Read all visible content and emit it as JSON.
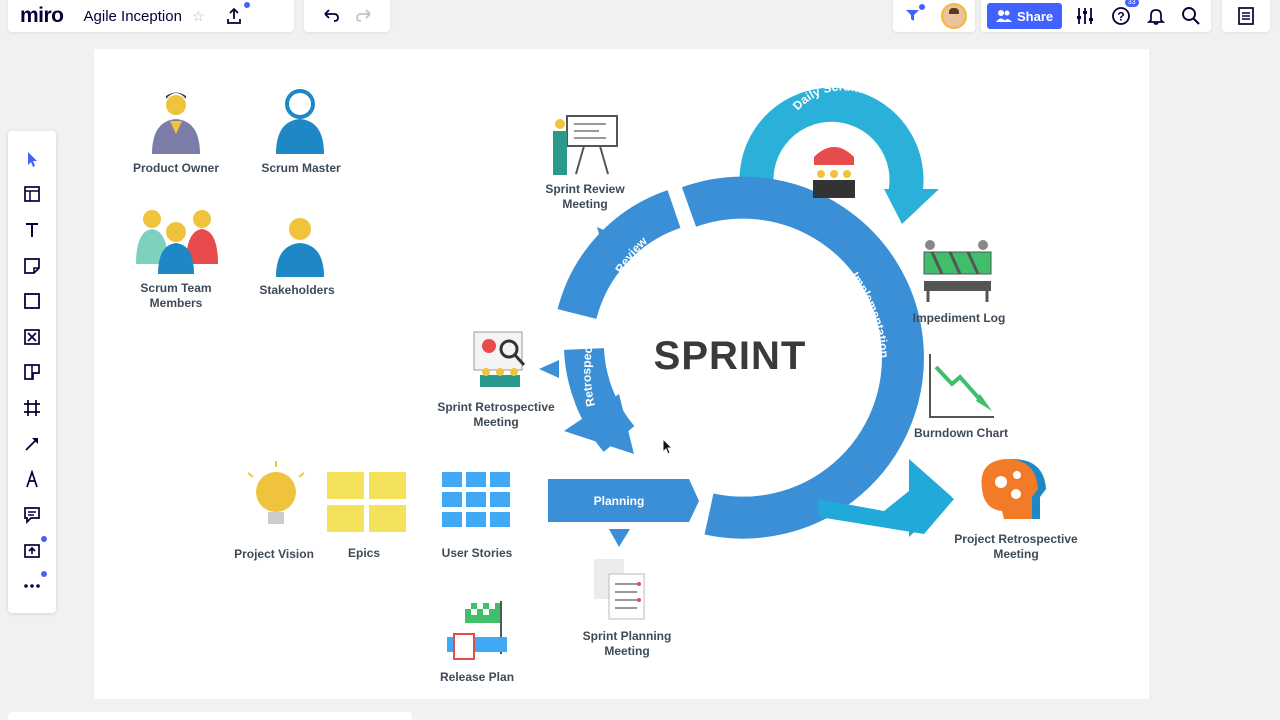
{
  "app": {
    "logo": "miro",
    "board_title": "Agile Inception"
  },
  "toolbar": {
    "share_label": "Share",
    "help_badge": "33",
    "tools": [
      "select-icon",
      "frames-icon",
      "text-icon",
      "sticky-note-icon",
      "shape-icon",
      "card-icon",
      "template-icon",
      "crop-frame-icon",
      "line-icon",
      "pen-icon",
      "comment-icon",
      "upload-icon",
      "more-icon"
    ]
  },
  "canvas": {
    "sprint_title": "SPRINT",
    "cycle": {
      "daily_scrum": "Daily Scrum",
      "review": "Review",
      "implementation": "Implementation",
      "retrospect": "Retrospect",
      "planning": "Planning"
    },
    "roles": {
      "product_owner": "Product Owner",
      "scrum_master": "Scrum Master",
      "scrum_team": "Scrum Team\nMembers",
      "stakeholders": "Stakeholders"
    },
    "artifacts": {
      "sprint_review": "Sprint Review\nMeeting",
      "impediment_log": "Impediment Log",
      "burndown_chart": "Burndown Chart",
      "sprint_retro": "Sprint Retrospective\nMeeting",
      "project_retro": "Project Retrospective\nMeeting",
      "project_vision": "Project Vision",
      "epics": "Epics",
      "user_stories": "User Stories",
      "sprint_planning": "Sprint Planning\nMeeting",
      "release_plan": "Release Plan"
    }
  },
  "colors": {
    "accent": "#4262ff",
    "cycle_blue": "#3a8fd6",
    "daily_blue": "#2bb0d9",
    "text_gray": "#3e4a57"
  }
}
